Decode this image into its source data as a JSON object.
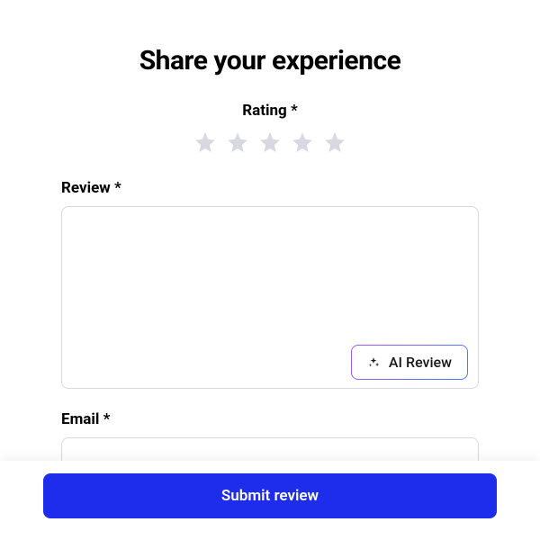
{
  "title": "Share your experience",
  "rating": {
    "label": "Rating",
    "required": "*",
    "value": 0,
    "max": 5
  },
  "review": {
    "label": "Review",
    "required": "*",
    "value": "",
    "ai_button_label": "AI Review"
  },
  "email": {
    "label": "Email",
    "required": "*",
    "value": ""
  },
  "submit_label": "Submit review",
  "colors": {
    "primary": "#1e2deb",
    "star_inactive": "#d8d8e0",
    "border": "#d8d8e0",
    "gradient_start": "#a855f7",
    "gradient_end": "#3b82f6"
  }
}
